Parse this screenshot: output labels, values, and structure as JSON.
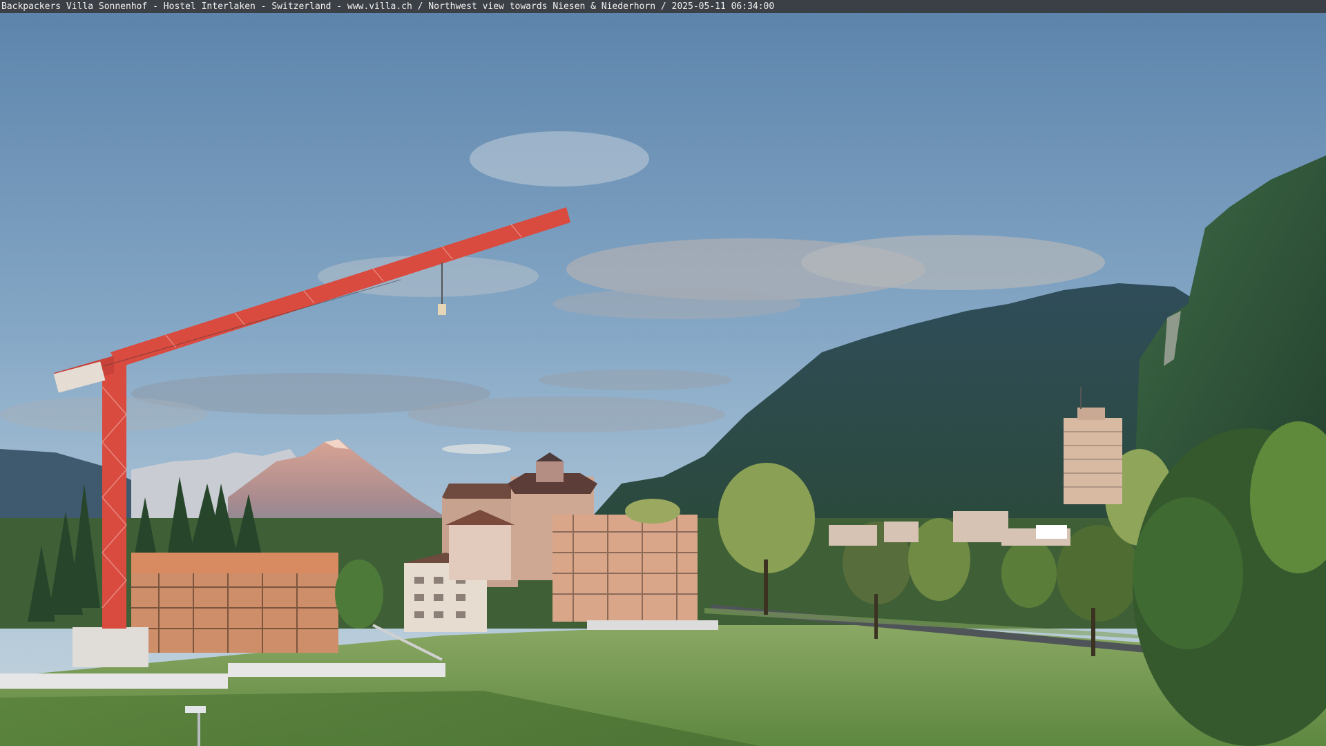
{
  "webcam": {
    "caption": "Backpackers Villa Sonnenhof - Hostel Interlaken - Switzerland - www.villa.ch / Northwest view towards Niesen & Niederhorn / 2025-05-11 06:34:00"
  },
  "colors": {
    "sky_top": "#5f86ad",
    "sky_bottom": "#b9cfdf",
    "crane": "#d94a3f",
    "mountain_sunlit": "#c98f82",
    "forest": "#2e4a3a",
    "meadow": "#6f9a4b",
    "facade": "#d9a689"
  }
}
